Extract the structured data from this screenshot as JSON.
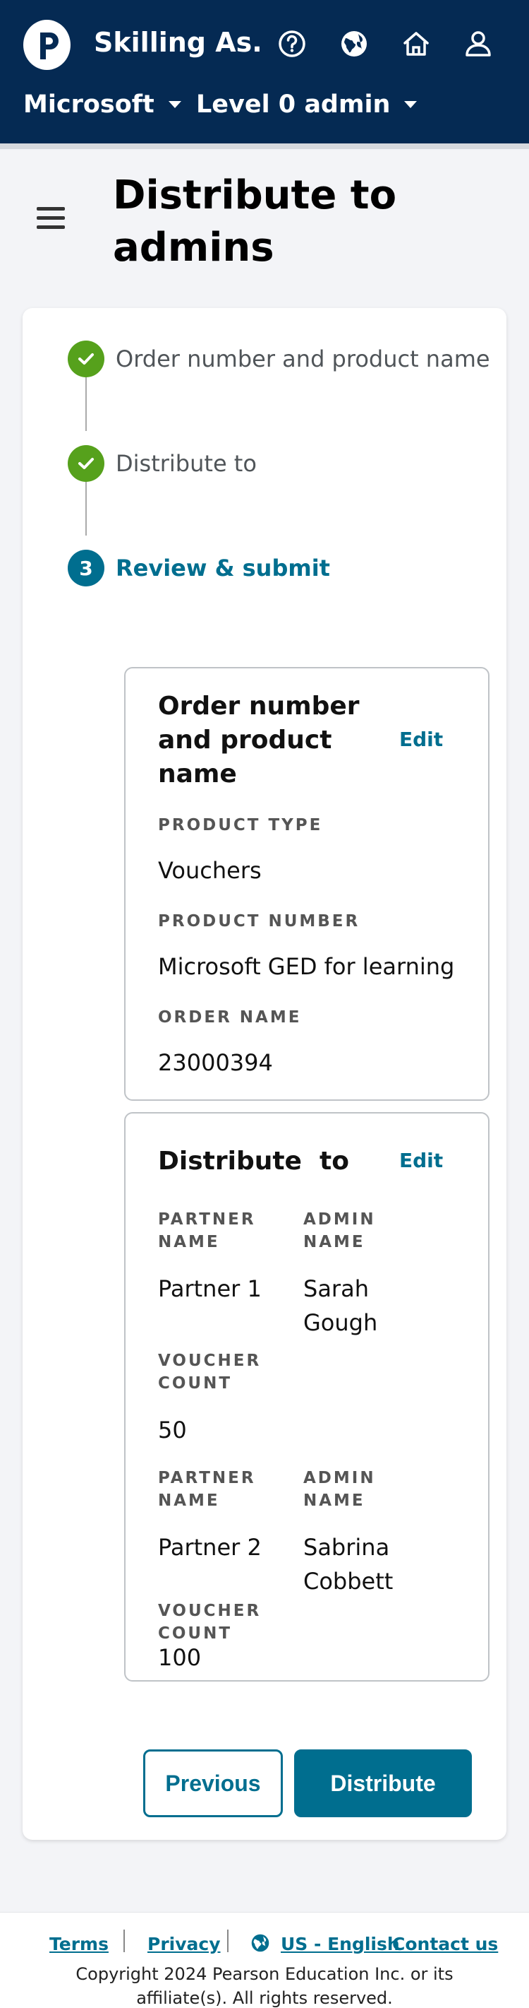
{
  "header": {
    "app_title": "Skilling As...",
    "org": "Microsoft",
    "role": "Level 0 admin",
    "icons": [
      "help-icon",
      "globe-icon",
      "home-icon",
      "user-icon"
    ]
  },
  "page": {
    "title": "Distribute to admins"
  },
  "steps": [
    {
      "label": "Order number and product name",
      "status": "done"
    },
    {
      "label": "Distribute to",
      "status": "done"
    },
    {
      "number": "3",
      "label": "Review & submit",
      "status": "current"
    }
  ],
  "order_section": {
    "title": "Order number and product name",
    "edit_label": "Edit",
    "product_type_label": "PRODUCT TYPE",
    "product_type": "Vouchers",
    "product_number_label": "PRODUCT NUMBER",
    "product_number": "Microsoft GED for learning",
    "order_name_label": "ORDER NAME",
    "order_name": "23000394"
  },
  "distribute_section": {
    "title": "Distribute  to",
    "edit_label": "Edit",
    "partner_name_label": "PARTNER NAME",
    "admin_name_label": "ADMIN NAME",
    "voucher_count_label": "VOUCHER COUNT",
    "rows": [
      {
        "partner": "Partner 1",
        "admin": "Sarah Gough",
        "count": "50"
      },
      {
        "partner": "Partner 2",
        "admin": "Sabrina Cobbett",
        "count": "100"
      }
    ]
  },
  "actions": {
    "previous": "Previous",
    "distribute": "Distribute"
  },
  "footer": {
    "terms": "Terms",
    "privacy": "Privacy",
    "language": "US - English",
    "contact": "Contact us",
    "copyright": "Copyright 2024 Pearson Education Inc. or its affiliate(s). All rights reserved."
  },
  "colors": {
    "header_bg": "#052a53",
    "accent": "#006e8f",
    "success": "#56a11c"
  }
}
